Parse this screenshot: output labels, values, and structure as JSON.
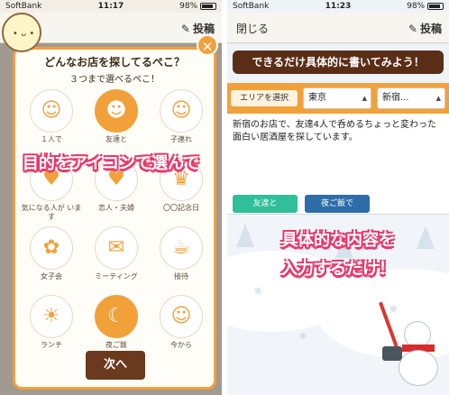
{
  "left": {
    "status": {
      "carrier": "SoftBank",
      "time": "11:17",
      "right": "98%"
    },
    "nav": {
      "right_label": "投稿"
    },
    "modal": {
      "title": "どんなお店を探してるぺこ？",
      "subtitle": "３つまで選べるぺこ！",
      "close_glyph": "✕",
      "options": [
        {
          "label": "１人で",
          "icon": "person-icon",
          "glyph": "☺",
          "selected": false
        },
        {
          "label": "友達と",
          "icon": "friends-icon",
          "glyph": "☻",
          "selected": true
        },
        {
          "label": "子連れ",
          "icon": "child-icon",
          "glyph": "☺",
          "selected": false
        },
        {
          "label": "気になる人が います",
          "icon": "crush-icon",
          "glyph": "♥",
          "selected": false
        },
        {
          "label": "恋人・夫婦",
          "icon": "couple-icon",
          "glyph": "♥",
          "selected": false
        },
        {
          "label": "〇〇記念日",
          "icon": "anniversary-icon",
          "glyph": "♛",
          "selected": false
        },
        {
          "label": "女子会",
          "icon": "girls-party-icon",
          "glyph": "✿",
          "selected": false
        },
        {
          "label": "ミーティング",
          "icon": "meeting-icon",
          "glyph": "✉",
          "selected": false
        },
        {
          "label": "接待",
          "icon": "business-entertainment-icon",
          "glyph": "☕",
          "selected": false
        },
        {
          "label": "ランチ",
          "icon": "lunch-icon",
          "glyph": "☀",
          "selected": false
        },
        {
          "label": "夜ご飯",
          "icon": "dinner-icon",
          "glyph": "☾",
          "selected": true
        },
        {
          "label": "今から",
          "icon": "now-icon",
          "glyph": "☺",
          "selected": false
        }
      ],
      "next_label": "次へ"
    },
    "banner": "目的をアイコンで選んで"
  },
  "right": {
    "status": {
      "carrier": "SoftBank",
      "time": "11:23",
      "right": "98%"
    },
    "nav": {
      "left_label": "閉じる",
      "right_label": "投稿"
    },
    "headline": "できるだけ具体的に書いてみよう！",
    "area": {
      "label": "エリアを選択",
      "prefecture": "東京",
      "city": "新宿..."
    },
    "body_text": "新宿のお店で、友達4人で呑めるちょっと変わった面白い居酒屋を探しています。",
    "tags": [
      {
        "label": "友達と",
        "color": "#2fbf9a"
      },
      {
        "label": "夜ご飯で",
        "color": "#2d6ea8"
      }
    ],
    "banner_line1": "具体的な内容を",
    "banner_line2": "入力するだけ！"
  },
  "colors": {
    "accent": "#f2a13a",
    "brown": "#5a2e16",
    "pink_outline": "#e8386a"
  }
}
